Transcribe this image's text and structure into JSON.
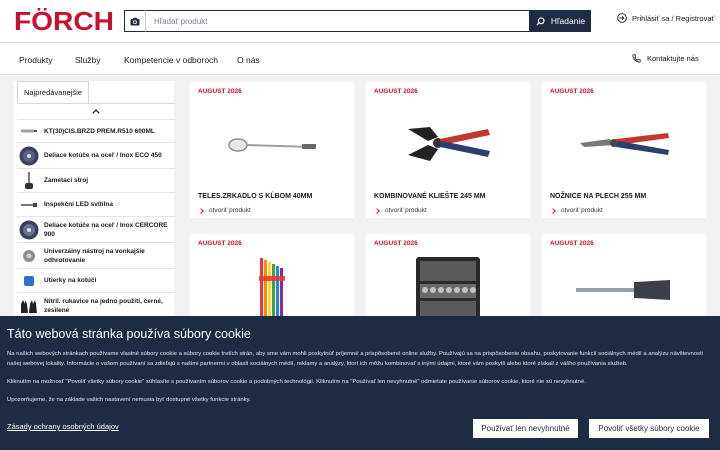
{
  "brand": {
    "name": "FÖRCH"
  },
  "header": {
    "search_placeholder": "Hľadať produkt",
    "search_button": "Hľadanie",
    "login": "Prihlásiť sa / Registrovať"
  },
  "nav": {
    "items": [
      "Produkty",
      "Služby",
      "Kompetencie v odboroch",
      "O nás"
    ],
    "contact": "Kontaktujte nás"
  },
  "sidebar": {
    "tab": "Najpredávanejšie",
    "items": [
      {
        "label": "KT(30)CIS.BRZD PREM.R510 600ML",
        "icon": "spray-can-icon"
      },
      {
        "label": "Deliace kotúče na oceľ / Inox ECO 450",
        "icon": "cutting-disc-icon"
      },
      {
        "label": "Zametací stroj",
        "icon": "sweeper-icon"
      },
      {
        "label": "Inspekční LED svítilna",
        "icon": "flashlight-icon"
      },
      {
        "label": "Deliace kotúče na oceľ / Inox CERCORE 900",
        "icon": "cutting-disc-icon"
      },
      {
        "label": "Univerzálny nástroj na vonkajšie odhrotovanie",
        "icon": "deburring-tool-icon"
      },
      {
        "label": "Utierky na kotúči",
        "icon": "wipes-roll-icon"
      },
      {
        "label": "Nitril. rukavice na jedno použití, černé, zesilené",
        "icon": "gloves-icon"
      }
    ]
  },
  "cards": [
    {
      "date": "AUGUST 2026",
      "title": "TELES.ZRKADLO S KĹBOM 40MM",
      "link": "otvoriť produkt",
      "icon": "inspection-mirror-icon"
    },
    {
      "date": "AUGUST 2026",
      "title": "KOMBINOVANÉ KLIEŠTE 245 MM",
      "link": "otvoriť produkt",
      "icon": "combination-pliers-icon"
    },
    {
      "date": "AUGUST 2026",
      "title": "NOŽNICE NA PLECH 255 MM",
      "link": "otvoriť produkt",
      "icon": "tin-snips-icon"
    },
    {
      "date": "AUGUST 2026",
      "title": "",
      "link": "",
      "icon": "hex-key-set-icon"
    },
    {
      "date": "AUGUST 2026",
      "title": "",
      "link": "",
      "icon": "socket-set-case-icon"
    },
    {
      "date": "AUGUST 2026",
      "title": "",
      "link": "",
      "icon": "scraper-icon"
    }
  ],
  "cookie": {
    "title": "Táto webová stránka používa súbory cookie",
    "p1": "Na našich webových stránkach používame vlastné súbory cookie a súbory cookie tretích strán, aby sme vám mohli poskytnúť príjemné a prispôsobené online služby. Používajú sa na prispôsobenie obsahu, poskytovanie funkcií sociálnych médií a analýzu návštevnosti našej webovej lokality. Informácie o vašom používaní sa zdieľajú s našimi partnermi v oblasti sociálnych médií, reklamy a analýzy, ktorí ich môžu kombinovať s inými údajmi, ktoré vám poskytli alebo ktoré získali z vášho používania služieb.",
    "p2": "Kliknutím na možnosť \"Povoliť všetky súbory cookie\" súhlasíte s používaním súborov cookie a podobných technológií. Kliknutím na \"Používať len nevyhnutné\" odmietate používanie súborov cookie, ktoré nie sú nevyhnutné.",
    "p3": "Upozorňujeme, že na základe vašich nastavení nemusia byť dostupné všetky funkcie stránky.",
    "privacy_link": "Zásady ochrany osobných údajov",
    "btn_necessary": "Používať len nevyhnutné",
    "btn_all": "Povoliť všetky súbory cookie"
  },
  "colors": {
    "navy": "#1d2b45",
    "brand_red": "#c8102e",
    "background": "#f1f1f2"
  }
}
